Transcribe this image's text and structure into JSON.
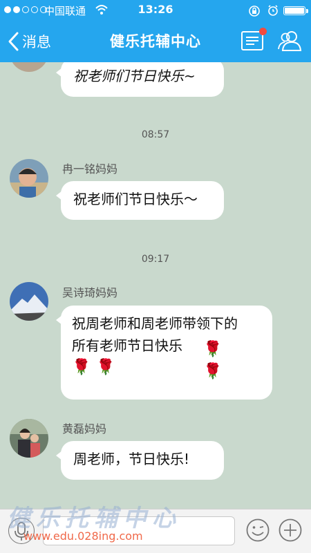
{
  "status_bar": {
    "carrier": "中国联通",
    "time": "13:26",
    "signal_bars_filled": 2,
    "signal_bars_total": 5
  },
  "nav": {
    "back_label": "消息",
    "title": "健乐托辅中心",
    "menu_icon": "list-icon",
    "people_icon": "people-icon",
    "has_unread_dot": true
  },
  "chat": {
    "messages": [
      {
        "text": "祝老师们节日快乐~"
      },
      {
        "timestamp": "08:57",
        "sender": "冉一铭妈妈",
        "text": "祝老师们节日快乐～"
      },
      {
        "timestamp": "09:17",
        "sender": "吴诗琦妈妈",
        "text_line1": "祝周老师和周老师带领下的",
        "text_line2": "所有老师节日快乐",
        "roses": "🌹🌹🌹🌹"
      },
      {
        "sender": "黄磊妈妈",
        "text": "周老师，节日快乐!"
      }
    ]
  },
  "input_bar": {
    "mic_icon": "microphone-icon",
    "emoji_icon": "smiley-icon",
    "plus_icon": "plus-icon"
  },
  "watermark": {
    "brand_chars": "健乐托辅中心",
    "url": "www.edu.028ing.com"
  },
  "colors": {
    "header": "#25a6ee",
    "chat_background": "#c9d9cd",
    "bubble": "#ffffff",
    "unread_dot": "#f24b3f"
  }
}
